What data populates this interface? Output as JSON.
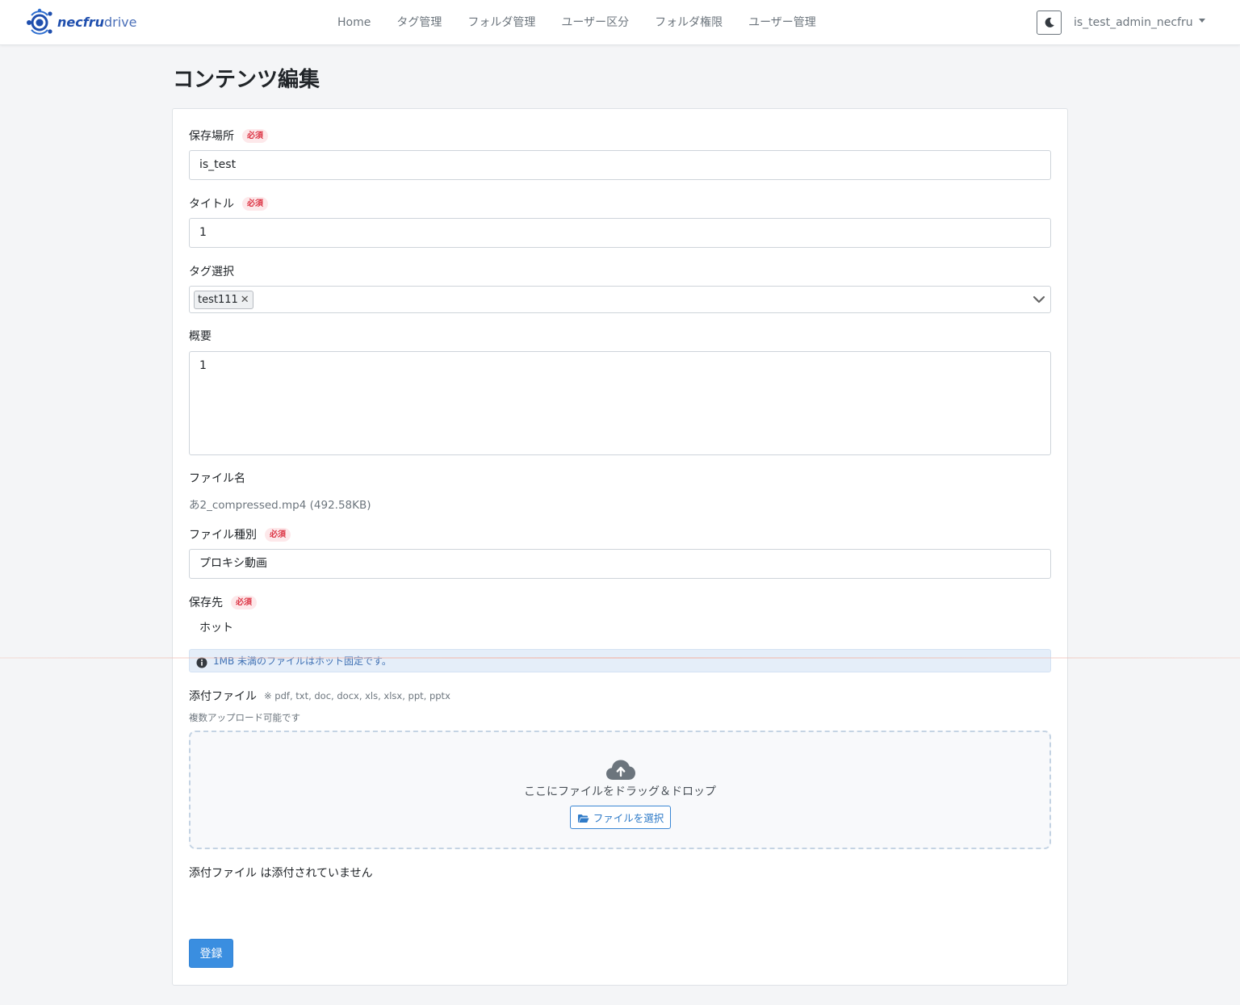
{
  "app": {
    "brand_bold": "necfru",
    "brand_light": "drive"
  },
  "nav": {
    "items": [
      {
        "label": "Home"
      },
      {
        "label": "タグ管理"
      },
      {
        "label": "フォルダ管理"
      },
      {
        "label": "ユーザー区分"
      },
      {
        "label": "フォルダ権限"
      },
      {
        "label": "ユーザー管理"
      }
    ],
    "theme_icon": "moon-icon",
    "user": "is_test_admin_necfru"
  },
  "page": {
    "title": "コンテンツ編集"
  },
  "form": {
    "required_badge": "必須",
    "location": {
      "label": "保存場所",
      "value": "is_test"
    },
    "title": {
      "label": "タイトル",
      "value": "1"
    },
    "tags": {
      "label": "タグ選択",
      "selected": [
        "test111"
      ],
      "remove_glyph": "✕"
    },
    "summary": {
      "label": "概要",
      "value": "1"
    },
    "file_name": {
      "label": "ファイル名",
      "value": "あ2_compressed.mp4 (492.58KB)"
    },
    "file_type": {
      "label": "ファイル種別",
      "value": "プロキシ動画"
    },
    "storage": {
      "label": "保存先",
      "value": "ホット",
      "info": "1MB 未満のファイルはホット固定です。"
    },
    "attachments": {
      "label": "添付ファイル",
      "hint": "※ pdf, txt, doc, docx, xls, xlsx, ppt, pptx",
      "multi_note": "複数アップロード可能です",
      "drop_text": "ここにファイルをドラッグ＆ドロップ",
      "select_button": "ファイルを選択",
      "none_text": "添付ファイル は添付されていません"
    },
    "submit_label": "登録"
  },
  "colors": {
    "primary": "#3a8ee0",
    "required": "#dc3545",
    "info_bg": "#e5eef9",
    "brand": "#1f4fae"
  }
}
